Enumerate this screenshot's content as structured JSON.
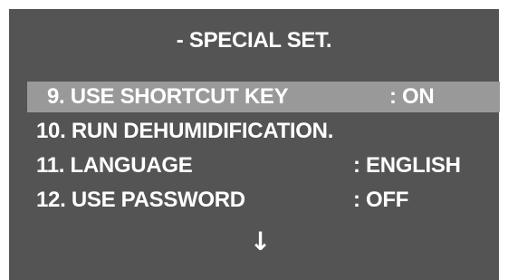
{
  "menu": {
    "title": "- SPECIAL SET.",
    "items": [
      {
        "label": "9. USE SHORTCUT KEY",
        "value": ": ON",
        "selected": true
      },
      {
        "label": "10. RUN DEHUMIDIFICATION.",
        "value": ""
      },
      {
        "label": "11. LANGUAGE",
        "value": ": ENGLISH"
      },
      {
        "label": "12. USE PASSWORD",
        "value": ": OFF"
      }
    ],
    "scroll_indicator": "↓"
  },
  "colors": {
    "background": "#545454",
    "highlight": "#999999",
    "text": "#ffffff"
  }
}
